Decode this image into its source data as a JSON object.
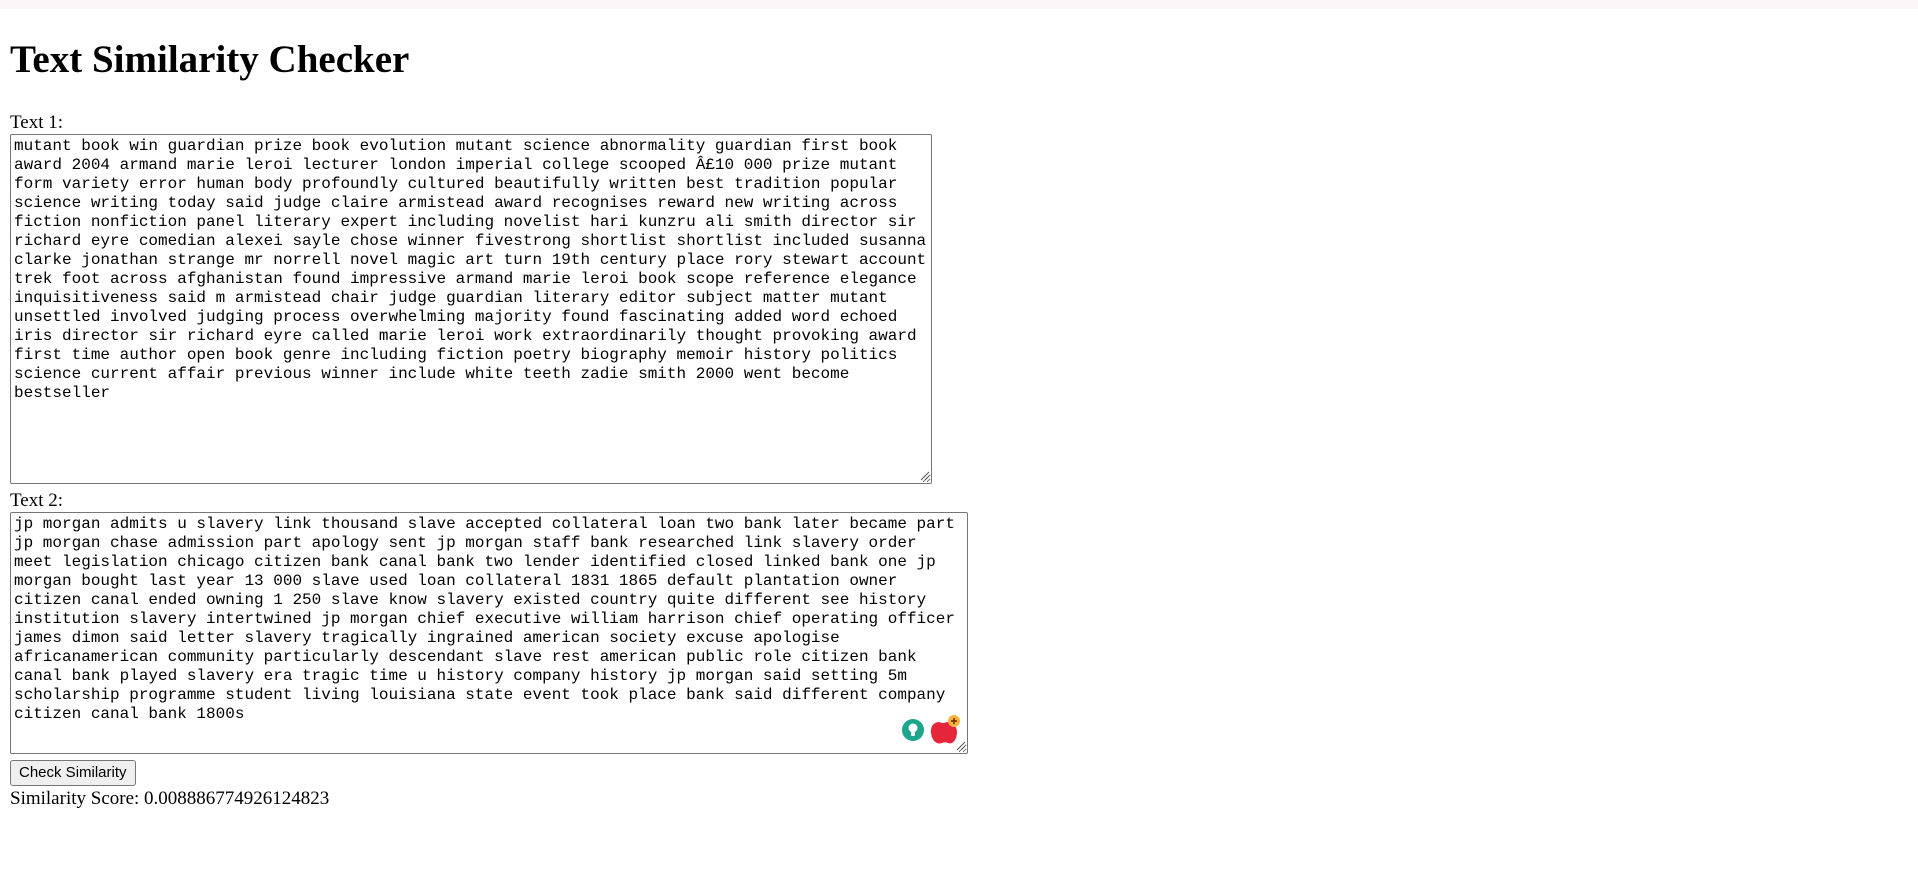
{
  "page": {
    "title": "Text Similarity Checker"
  },
  "form": {
    "text1_label": "Text 1:",
    "text1_value": "mutant book win guardian prize book evolution mutant science abnormality guardian first book award 2004 armand marie leroi lecturer london imperial college scooped Â£10 000 prize mutant form variety error human body profoundly cultured beautifully written best tradition popular science writing today said judge claire armistead award recognises reward new writing across fiction nonfiction panel literary expert including novelist hari kunzru ali smith director sir richard eyre comedian alexei sayle chose winner fivestrong shortlist shortlist included susanna clarke jonathan strange mr norrell novel magic art turn 19th century place rory stewart account trek foot across afghanistan found impressive armand marie leroi book scope reference elegance inquisitiveness said m armistead chair judge guardian literary editor subject matter mutant unsettled involved judging process overwhelming majority found fascinating added word echoed iris director sir richard eyre called marie leroi work extraordinarily thought provoking award first time author open book genre including fiction poetry biography memoir history politics science current affair previous winner include white teeth zadie smith 2000 went become bestseller",
    "text2_label": "Text 2:",
    "text2_value": "jp morgan admits u slavery link thousand slave accepted collateral loan two bank later became part jp morgan chase admission part apology sent jp morgan staff bank researched link slavery order meet legislation chicago citizen bank canal bank two lender identified closed linked bank one jp morgan bought last year 13 000 slave used loan collateral 1831 1865 default plantation owner citizen canal ended owning 1 250 slave know slavery existed country quite different see history institution slavery intertwined jp morgan chief executive william harrison chief operating officer james dimon said letter slavery tragically ingrained american society excuse apologise africanamerican community particularly descendant slave rest american public role citizen bank canal bank played slavery era tragic time u history company history jp morgan said setting 5m scholarship programme student living louisiana state event took place bank said different company citizen canal bank 1800s",
    "button_label": "Check Similarity",
    "result_text": "Similarity Score: 0.008886774926124823"
  },
  "icons": {
    "resize_handle": "resize-grip-icon",
    "extension_bulb": "lightbulb-icon",
    "extension_apple": "apple-plus-icon"
  },
  "colors": {
    "top_strip": "#fbf7f8",
    "textarea_border": "#767676",
    "button_bg": "#efefef",
    "ext_bulb": "#1aa58c",
    "ext_apple": "#e5253a",
    "ext_plus_bg": "#f4b33d"
  }
}
